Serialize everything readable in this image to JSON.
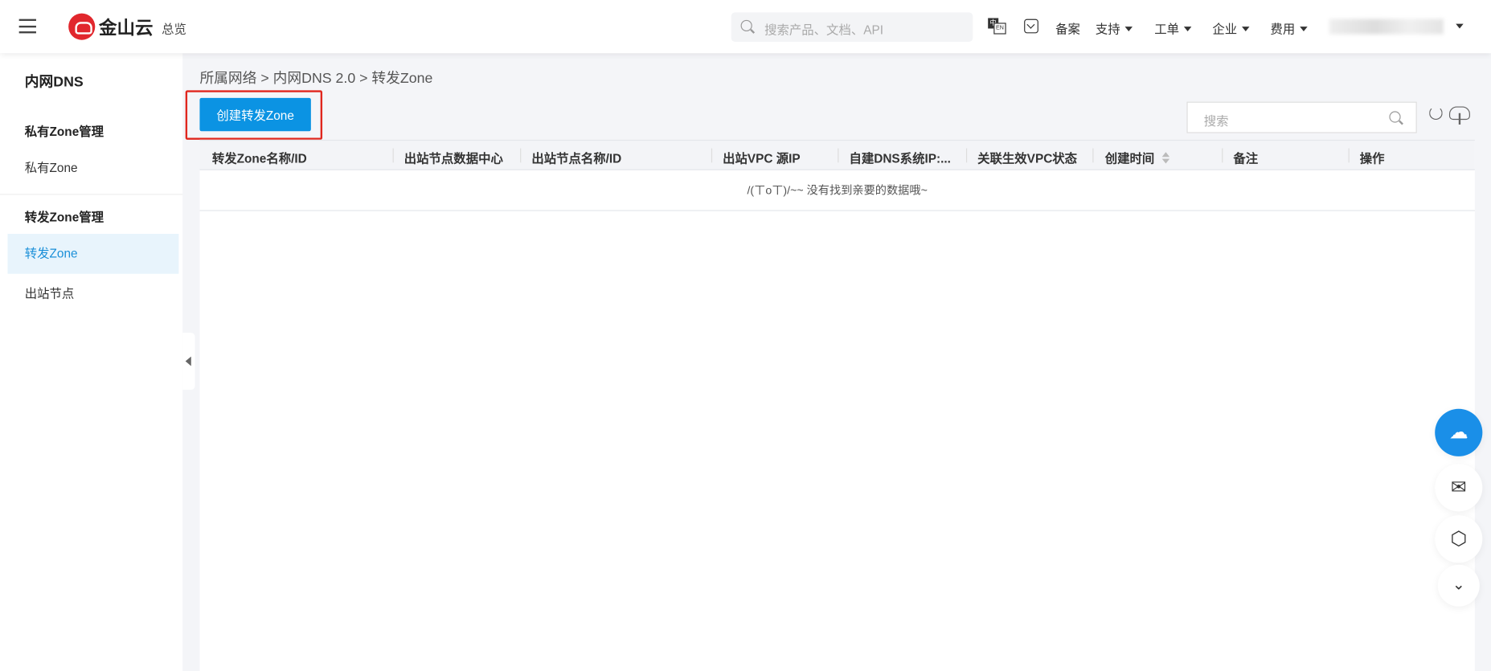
{
  "topbar": {
    "logo_text": "金山云",
    "overview": "总览",
    "search_placeholder": "搜索产品、文档、API",
    "lang_a": "中",
    "lang_b": "EN",
    "nav": [
      "备案",
      "支持",
      "工单",
      "企业",
      "费用"
    ]
  },
  "sidebar": {
    "title": "内网DNS",
    "groups": [
      {
        "label": "私有Zone管理",
        "items": [
          "私有Zone"
        ]
      },
      {
        "label": "转发Zone管理",
        "items": [
          "转发Zone",
          "出站节点"
        ]
      }
    ],
    "active": "转发Zone"
  },
  "breadcrumb": "所属网络 > 内网DNS 2.0 > 转发Zone",
  "toolbar": {
    "create_label": "创建转发Zone",
    "search_placeholder": "搜索"
  },
  "table": {
    "columns": [
      "转发Zone名称/ID",
      "出站节点数据中心",
      "出站节点名称/ID",
      "出站VPC 源IP",
      "自建DNS系统IP:...",
      "关联生效VPC状态",
      "创建时间",
      "备注",
      "操作"
    ],
    "empty_text": "/(ㄒoㄒ)/~~ 没有找到亲要的数据哦~"
  },
  "colors": {
    "primary": "#0b93e3",
    "highlight": "#e0261d",
    "brand": "#e1272d"
  }
}
